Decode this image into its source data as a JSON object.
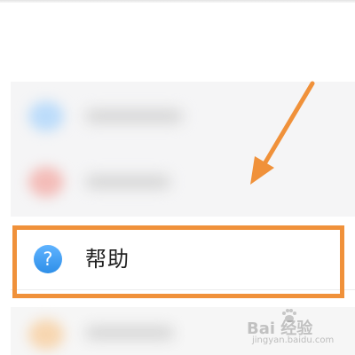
{
  "menu": {
    "help_item": {
      "label": "帮助",
      "icon": "question-circle-icon",
      "icon_glyph": "?",
      "icon_color": "#3d9ef5"
    }
  },
  "annotation": {
    "highlight_color": "#f0913a",
    "arrow_color": "#f0913a"
  },
  "watermark": {
    "brand": "Bai 经验",
    "url": "jingyan.baidu.com"
  }
}
